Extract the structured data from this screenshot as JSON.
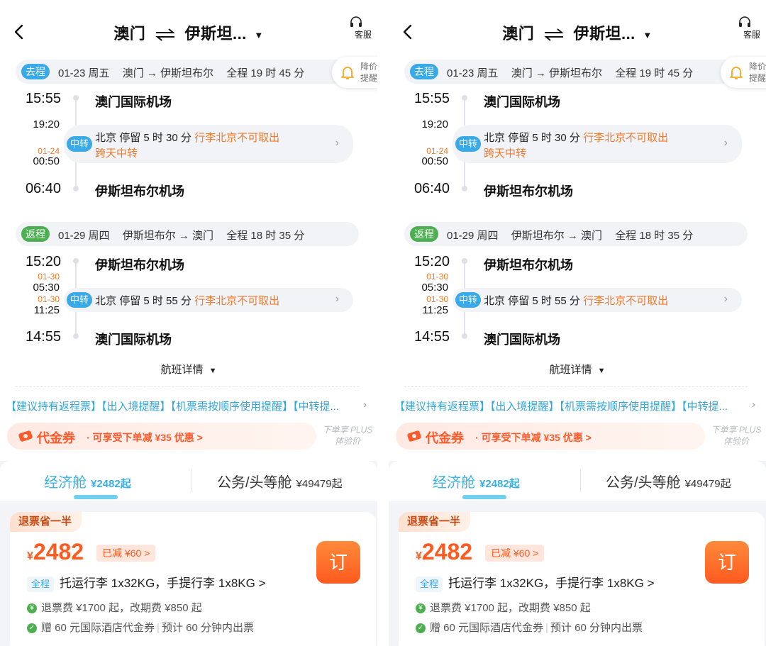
{
  "panels": [
    {
      "title_from": "澳门",
      "title_to": "伊斯坦...",
      "service_label": "客服",
      "price_alert_label": "降价提醒",
      "outbound": {
        "tag": "去程",
        "date": "01-23 周五",
        "route": "澳门 → 伊斯坦布尔",
        "duration": "全程 19 时 45 分",
        "dep_time": "15:55",
        "dep_airport": "澳门国际机场",
        "arr_transfer_time": "19:20",
        "dep_transfer_date": "01-24",
        "dep_transfer_time": "00:50",
        "transfer_tag": "中转",
        "transfer_city": "北京",
        "transfer_stay": "停留 5 时 30 分",
        "transfer_warn": "行李北京不可取出",
        "transfer_warn2": "跨天中转",
        "arr_time": "06:40",
        "arr_airport": "伊斯坦布尔机场"
      },
      "return": {
        "tag": "返程",
        "date": "01-29 周四",
        "route": "伊斯坦布尔 → 澳门",
        "duration": "全程 18 时 35 分",
        "dep_time": "15:20",
        "dep_airport": "伊斯坦布尔机场",
        "arr_transfer_date": "01-30",
        "arr_transfer_time": "05:30",
        "dep_transfer_date": "01-30",
        "dep_transfer_time": "11:25",
        "transfer_tag": "中转",
        "transfer_city": "北京",
        "transfer_stay": "停留 5 时 55 分",
        "transfer_warn": "行李北京不可取出",
        "arr_time": "14:55",
        "arr_airport": "澳门国际机场"
      },
      "details_label": "航班详情",
      "notice": "【建议持有返程票】【出入境提醒】【机票需按顺序使用提醒】【中转提...",
      "voucher_title": "代金券",
      "voucher_desc": "· 可享受下单减 ¥35 优惠  >",
      "plus_label": "下单享 PLUS体验价",
      "tab_economy": "经济舱",
      "tab_economy_price": "¥2482起",
      "tab_business": "公务/头等舱",
      "tab_business_price": "¥49479起",
      "refund_tag": "退票省一半",
      "price_currency": "¥",
      "price_value": "2482",
      "discount": "已减 ¥60 >",
      "book_label": "订",
      "baggage_tag": "全程",
      "baggage": "托运行李 1x32KG，手提行李 1x8KG >",
      "fee_icon": "¥",
      "fee": "退票费 ¥1700 起，改期费 ¥850 起",
      "gift_a": "赠 60 元国际酒店代金券",
      "gift_b": "预计 60 分钟内出票"
    },
    {
      "title_from": "澳门",
      "title_to": "伊斯坦...",
      "service_label": "客服",
      "price_alert_label": "降价提醒",
      "outbound": {
        "tag": "去程",
        "date": "01-23 周五",
        "route": "澳门 → 伊斯坦布尔",
        "duration": "全程 19 时 45 分",
        "dep_time": "15:55",
        "dep_airport": "澳门国际机场",
        "arr_transfer_time": "19:20",
        "dep_transfer_date": "01-24",
        "dep_transfer_time": "00:50",
        "transfer_tag": "中转",
        "transfer_city": "北京",
        "transfer_stay": "停留 5 时 30 分",
        "transfer_warn": "行李北京不可取出",
        "transfer_warn2": "跨天中转",
        "arr_time": "06:40",
        "arr_airport": "伊斯坦布尔机场"
      },
      "return": {
        "tag": "返程",
        "date": "01-29 周四",
        "route": "伊斯坦布尔 → 澳门",
        "duration": "全程 18 时 35 分",
        "dep_time": "15:20",
        "dep_airport": "伊斯坦布尔机场",
        "arr_transfer_date": "01-30",
        "arr_transfer_time": "05:30",
        "dep_transfer_date": "01-30",
        "dep_transfer_time": "11:25",
        "transfer_tag": "中转",
        "transfer_city": "北京",
        "transfer_stay": "停留 5 时 55 分",
        "transfer_warn": "行李北京不可取出",
        "arr_time": "14:55",
        "arr_airport": "澳门国际机场"
      },
      "details_label": "航班详情",
      "notice": "【建议持有返程票】【出入境提醒】【机票需按顺序使用提醒】【中转提...",
      "voucher_title": "代金券",
      "voucher_desc": "· 可享受下单减 ¥35 优惠  >",
      "plus_label": "下单享 PLUS体验价",
      "tab_economy": "经济舱",
      "tab_economy_price": "¥2482起",
      "tab_business": "公务/头等舱",
      "tab_business_price": "¥49479起",
      "refund_tag": "退票省一半",
      "price_currency": "¥",
      "price_value": "2482",
      "discount": "已减 ¥60 >",
      "book_label": "订",
      "baggage_tag": "全程",
      "baggage": "托运行李 1x32KG，手提行李 1x8KG >",
      "fee_icon": "¥",
      "fee": "退票费 ¥1700 起，改期费 ¥850 起",
      "gift_a": "赠 60 元国际酒店代金券",
      "gift_b": "预计 60 分钟内出票"
    }
  ],
  "colors": {
    "accent_blue": "#3aa9e8",
    "accent_orange": "#f07a2c",
    "price_red": "#ff5a1f",
    "return_green": "#4caf50"
  }
}
